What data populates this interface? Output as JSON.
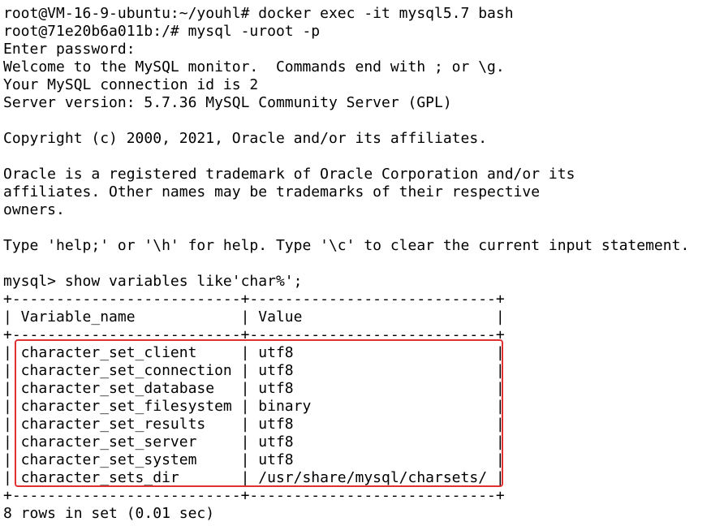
{
  "terminal": {
    "lines": [
      "root@VM-16-9-ubuntu:~/youhl# docker exec -it mysql5.7 bash",
      "root@71e20b6a011b:/# mysql -uroot -p",
      "Enter password:",
      "Welcome to the MySQL monitor.  Commands end with ; or \\g.",
      "Your MySQL connection id is 2",
      "Server version: 5.7.36 MySQL Community Server (GPL)",
      "",
      "Copyright (c) 2000, 2021, Oracle and/or its affiliates.",
      "",
      "Oracle is a registered trademark of Oracle Corporation and/or its",
      "affiliates. Other names may be trademarks of their respective",
      "owners.",
      "",
      "Type 'help;' or '\\h' for help. Type '\\c' to clear the current input statement.",
      "",
      "mysql> show variables like'char%';",
      "+--------------------------+----------------------------+",
      "| Variable_name            | Value                      |",
      "+--------------------------+----------------------------+",
      "| character_set_client     | utf8                       |",
      "| character_set_connection | utf8                       |",
      "| character_set_database   | utf8                       |",
      "| character_set_filesystem | binary                     |",
      "| character_set_results    | utf8                       |",
      "| character_set_server     | utf8                       |",
      "| character_set_system     | utf8                       |",
      "| character_sets_dir       | /usr/share/mysql/charsets/ |",
      "+--------------------------+----------------------------+",
      "8 rows in set (0.01 sec)"
    ]
  },
  "colors": {
    "background": "#ffffff",
    "text": "#000000",
    "highlight_border": "#e03030"
  }
}
